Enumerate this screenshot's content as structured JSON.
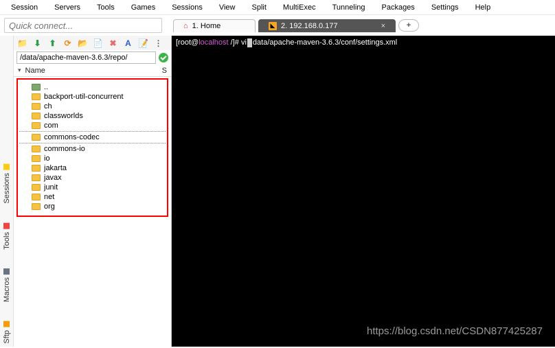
{
  "menu": [
    "Session",
    "Servers",
    "Tools",
    "Games",
    "Sessions",
    "View",
    "Split",
    "MultiExec",
    "Tunneling",
    "Packages",
    "Settings",
    "Help"
  ],
  "quick_placeholder": "Quick connect...",
  "tabs": {
    "home": {
      "label": "1. Home"
    },
    "active": {
      "label": "2. 192.168.0.177",
      "close": "×"
    },
    "plus": "+"
  },
  "toolbar_icons": [
    "folder",
    "download",
    "upload",
    "refresh",
    "newdir",
    "copy",
    "delete",
    "find",
    "edit",
    "more"
  ],
  "toolbar_glyphs": {
    "folder": "📁",
    "download": "⬇",
    "upload": "⬆",
    "refresh": "⟳",
    "newdir": "📂",
    "copy": "📄",
    "delete": "✖",
    "find": "A",
    "edit": "📝",
    "more": "⋮"
  },
  "toolbar_colors": {
    "folder": "#f6a623",
    "download": "#2e9e46",
    "upload": "#2e9e46",
    "refresh": "#f08b1d",
    "newdir": "#2e9e46",
    "copy": "#49a0e8",
    "delete": "#e86b6b",
    "find": "#2a5bd7",
    "edit": "#f6a623",
    "more": "#666"
  },
  "path": "/data/apache-maven-3.6.3/repo/",
  "header": {
    "name": "Name",
    "size": "S",
    "tri": "▾"
  },
  "tree": [
    {
      "label": "..",
      "up": true
    },
    {
      "label": "backport-util-concurrent"
    },
    {
      "label": "ch"
    },
    {
      "label": "classworlds"
    },
    {
      "label": "com"
    },
    {
      "label": "commons-codec",
      "sep_before": true,
      "sep_after": true
    },
    {
      "label": "commons-io"
    },
    {
      "label": "io"
    },
    {
      "label": "jakarta"
    },
    {
      "label": "javax"
    },
    {
      "label": "junit"
    },
    {
      "label": "net"
    },
    {
      "label": "org"
    }
  ],
  "side_tabs": [
    {
      "label": "Sftp",
      "color": "#f59e0b"
    },
    {
      "label": "Macros",
      "color": "#6b7280"
    },
    {
      "label": "Tools",
      "color": "#ef4444"
    },
    {
      "label": "Sessions",
      "color": "#facc15"
    }
  ],
  "terminal": {
    "prompt_user": "[root@",
    "prompt_host": "localhost",
    "prompt_tail": " /]# ",
    "cmd_before": "vi",
    "cmd_after": "data/apache-maven-3.6.3/conf/settings.xml"
  },
  "watermark": "https://blog.csdn.net/CSDN877425287"
}
